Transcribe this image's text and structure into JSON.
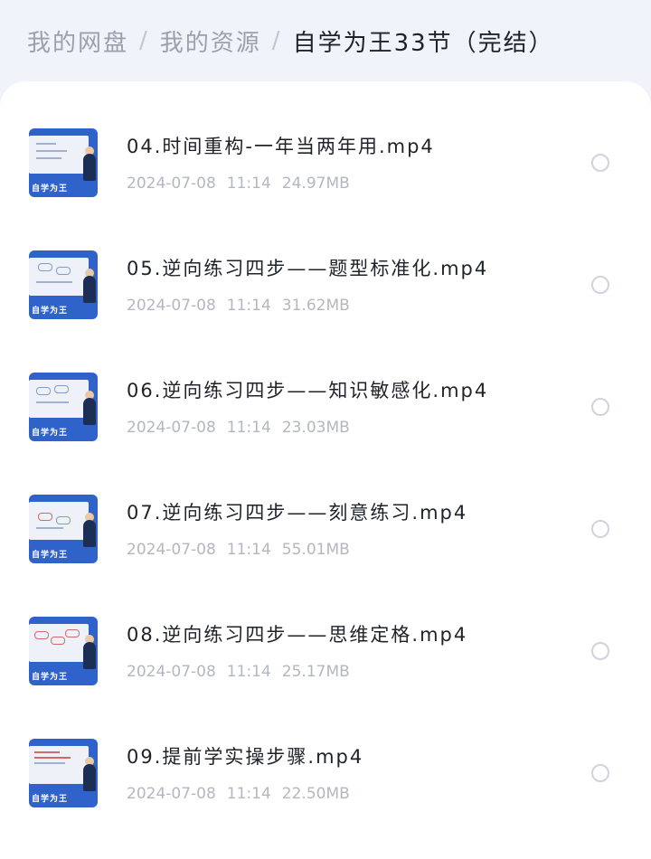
{
  "breadcrumb": {
    "items": [
      "我的网盘",
      "我的资源",
      "自学为王33节（完结）"
    ],
    "separator": "/"
  },
  "files": [
    {
      "name": "04.时间重构-一年当两年用.mp4",
      "date": "2024-07-08",
      "time": "11:14",
      "size": "24.97MB",
      "thumb_label": "自学为王"
    },
    {
      "name": "05.逆向练习四步——题型标准化.mp4",
      "date": "2024-07-08",
      "time": "11:14",
      "size": "31.62MB",
      "thumb_label": "自学为王"
    },
    {
      "name": "06.逆向练习四步——知识敏感化.mp4",
      "date": "2024-07-08",
      "time": "11:14",
      "size": "23.03MB",
      "thumb_label": "自学为王"
    },
    {
      "name": "07.逆向练习四步——刻意练习.mp4",
      "date": "2024-07-08",
      "time": "11:14",
      "size": "55.01MB",
      "thumb_label": "自学为王"
    },
    {
      "name": "08.逆向练习四步——思维定格.mp4",
      "date": "2024-07-08",
      "time": "11:14",
      "size": "25.17MB",
      "thumb_label": "自学为王"
    },
    {
      "name": "09.提前学实操步骤.mp4",
      "date": "2024-07-08",
      "time": "11:14",
      "size": "22.50MB",
      "thumb_label": "自学为王"
    }
  ],
  "colors": {
    "background": "#f0f3fa",
    "panel": "#ffffff",
    "text_primary": "#1f2329",
    "text_secondary": "#b3b7bf",
    "breadcrumb_inactive": "#9aa0ac",
    "thumb_blue": "#2f63c9"
  },
  "icons": {
    "select": "radio-unchecked-icon",
    "thumbnail": "video-thumbnail"
  }
}
